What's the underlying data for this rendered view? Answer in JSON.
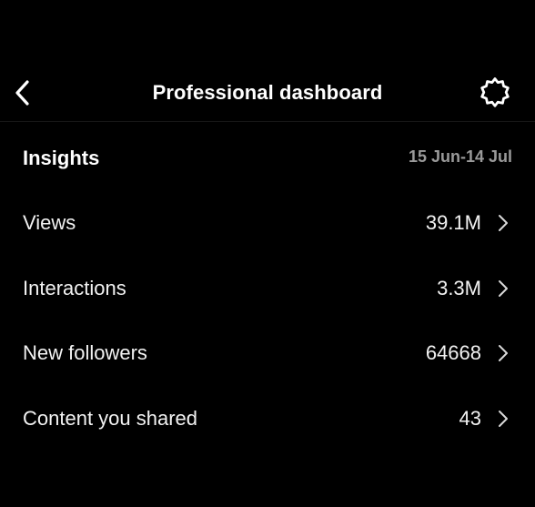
{
  "header": {
    "title": "Professional dashboard",
    "back_icon": "chevron-left-icon",
    "settings_icon": "gear-icon"
  },
  "insights": {
    "title": "Insights",
    "date_range": "15 Jun-14 Jul",
    "metrics": [
      {
        "label": "Views",
        "value": "39.1M"
      },
      {
        "label": "Interactions",
        "value": "3.3M"
      },
      {
        "label": "New followers",
        "value": "64668"
      },
      {
        "label": "Content you shared",
        "value": "43"
      }
    ],
    "row_icon": "chevron-right-icon"
  },
  "colors": {
    "background": "#000000",
    "text_primary": "#ffffff",
    "text_secondary": "#9a9a9a",
    "divider": "#161616"
  }
}
